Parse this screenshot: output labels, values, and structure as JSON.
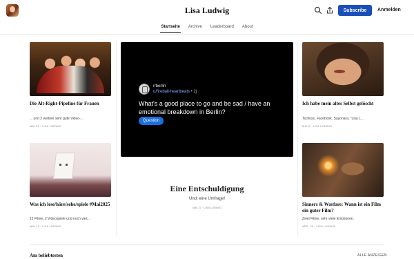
{
  "header": {
    "site_title": "Lisa Ludwig",
    "subscribe_label": "Subscribe",
    "login_label": "Anmelden",
    "icons": [
      "search-icon",
      "share-icon"
    ]
  },
  "nav": {
    "tabs": [
      "Startseite",
      "Archive",
      "Leaderboard",
      "About"
    ],
    "active": "Startseite"
  },
  "posts": [
    {
      "title": "Die Alt-Right-Pipeline für Frauen",
      "subtitle": "... und 2 weitere sehr gute Video-...",
      "meta": "MAI 25 · LISA LUDWIG"
    },
    {
      "title": "Was ich lese/höre/sehe/spiele #Mai2025",
      "subtitle": "12 Filme, 2 Videospiele und noch viel...",
      "meta": "MAI 13 · LISA LUDWIG"
    },
    {
      "title": "Ich habe mein altes Selbst gelöscht",
      "subtitle": "Tschüss, Facebook. Sayonara, \"Lisa L...",
      "meta": "MAI 6 · LISA LUDWIG"
    },
    {
      "title": "Sinners & Warfare: Wann ist ein Film ein guter Film?",
      "subtitle": "Zwei Filme, sehr viele Emotionen.",
      "meta": "APR. 29 · LISA LUDWIG"
    }
  ],
  "featured": {
    "embed": {
      "subreddit": "r/berlin",
      "user": "u/fireball-heartbeats",
      "age": " • 2j",
      "post_title": "What's a good place to go and be sad / have an emotional breakdown in Berlin?",
      "flair": "Question"
    },
    "title": "Eine Entschuldigung",
    "subtitle": "Und: eine Umfrage!",
    "meta": "MAI 27 · LISA LUDWIG"
  },
  "popular": {
    "title": "Am beliebtesten",
    "show_all": "ALLE ANZEIGEN"
  },
  "colors": {
    "accent": "#1a4fba",
    "flair": "#1a6fe0",
    "embed_background": "#000000"
  }
}
